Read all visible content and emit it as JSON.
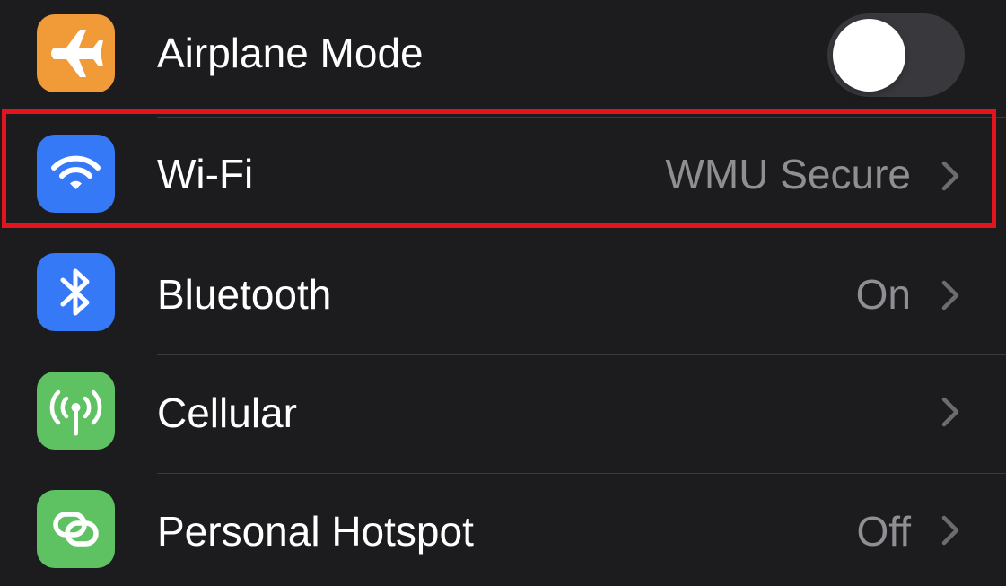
{
  "settings": {
    "rows": [
      {
        "name": "airplane-mode",
        "label": "Airplane Mode",
        "icon": "airplane-icon",
        "icon_color": "#f19a38",
        "control": "toggle",
        "toggle_on": false
      },
      {
        "name": "wifi",
        "label": "Wi-Fi",
        "icon": "wifi-icon",
        "icon_color": "#3579f6",
        "value": "WMU Secure",
        "chevron": true,
        "highlighted": true
      },
      {
        "name": "bluetooth",
        "label": "Bluetooth",
        "icon": "bluetooth-icon",
        "icon_color": "#3579f6",
        "value": "On",
        "chevron": true
      },
      {
        "name": "cellular",
        "label": "Cellular",
        "icon": "antenna-icon",
        "icon_color": "#5ec262",
        "value": "",
        "chevron": true
      },
      {
        "name": "personal-hotspot",
        "label": "Personal Hotspot",
        "icon": "chain-link-icon",
        "icon_color": "#5ec262",
        "value": "Off",
        "chevron": true
      }
    ]
  },
  "colors": {
    "background": "#1c1c1e",
    "separator": "#3a3a3c",
    "label_text": "#ffffff",
    "value_text": "#8e8e93",
    "toggle_track_off": "#39393d",
    "highlight_border": "#e3141d"
  }
}
